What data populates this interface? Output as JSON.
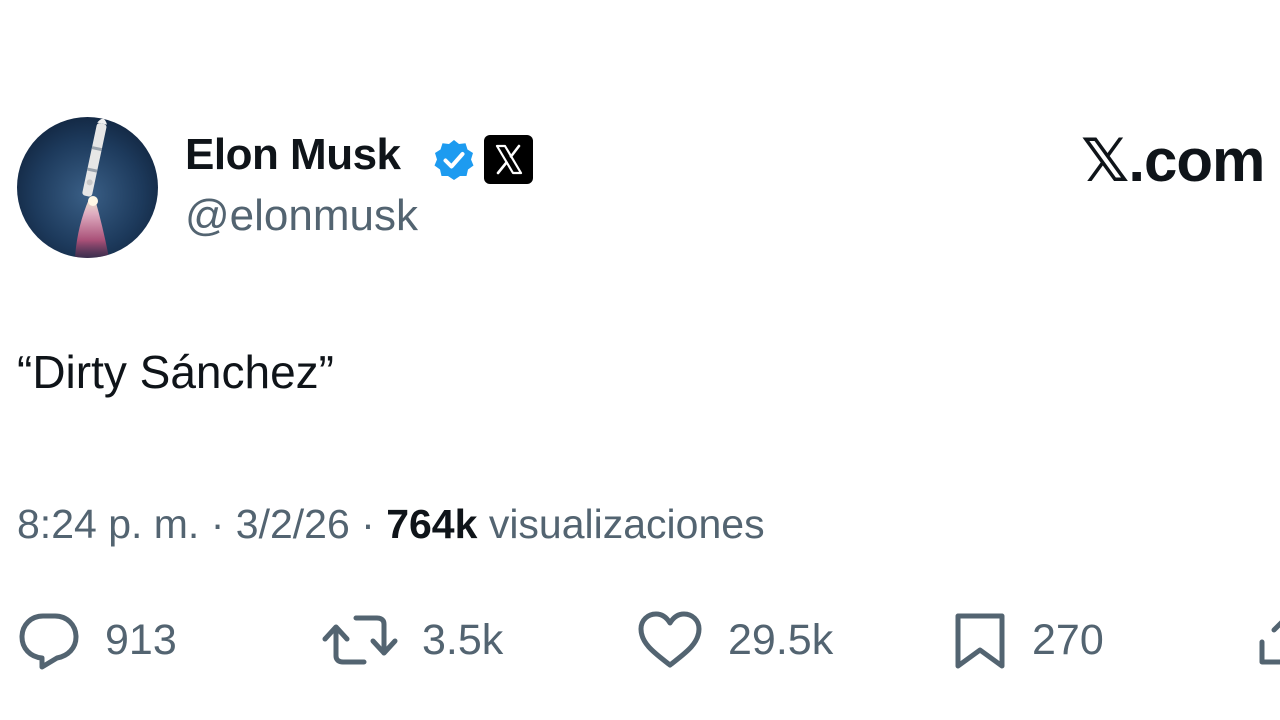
{
  "brand": {
    "watermark_text": "𝕏.com"
  },
  "post": {
    "author": {
      "name": "Elon Musk",
      "handle": "@elonmusk",
      "verified": true,
      "affiliate_badge_icon": "x-logo-icon",
      "avatar_icon": "rocket-launch-avatar"
    },
    "text": "“Dirty Sánchez”",
    "meta": {
      "time": "8:24 p. m.",
      "separator": " · ",
      "date": "3/2/26",
      "views_count": "764k",
      "views_label": "visualizaciones"
    },
    "actions": {
      "reply": {
        "icon": "reply-icon",
        "count": "913"
      },
      "repost": {
        "icon": "repost-icon",
        "count": "3.5k"
      },
      "like": {
        "icon": "heart-icon",
        "count": "29.5k"
      },
      "bookmark": {
        "icon": "bookmark-icon",
        "count": "270"
      },
      "share": {
        "icon": "share-icon"
      }
    }
  },
  "colors": {
    "text_primary": "#0f1419",
    "text_secondary": "#536471",
    "verified_blue": "#1d9bf0",
    "background": "#ffffff"
  }
}
